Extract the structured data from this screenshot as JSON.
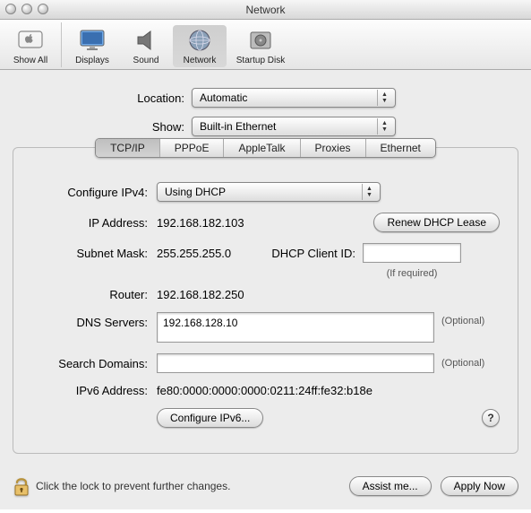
{
  "window": {
    "title": "Network"
  },
  "toolbar": {
    "items": [
      {
        "label": "Show All"
      },
      {
        "label": "Displays"
      },
      {
        "label": "Sound"
      },
      {
        "label": "Network"
      },
      {
        "label": "Startup Disk"
      }
    ]
  },
  "location": {
    "label": "Location:",
    "value": "Automatic"
  },
  "show": {
    "label": "Show:",
    "value": "Built-in Ethernet"
  },
  "tabs": [
    "TCP/IP",
    "PPPoE",
    "AppleTalk",
    "Proxies",
    "Ethernet"
  ],
  "activeTab": "TCP/IP",
  "tcpip": {
    "configure_label": "Configure IPv4:",
    "configure_value": "Using DHCP",
    "ip_label": "IP Address:",
    "ip_value": "192.168.182.103",
    "renew_label": "Renew DHCP Lease",
    "subnet_label": "Subnet Mask:",
    "subnet_value": "255.255.255.0",
    "client_id_label": "DHCP Client ID:",
    "client_id_value": "",
    "client_id_hint": "(If required)",
    "router_label": "Router:",
    "router_value": "192.168.182.250",
    "dns_label": "DNS Servers:",
    "dns_value": "192.168.128.10",
    "dns_optional": "(Optional)",
    "search_label": "Search Domains:",
    "search_value": "",
    "search_optional": "(Optional)",
    "ipv6_label": "IPv6 Address:",
    "ipv6_value": "fe80:0000:0000:0000:0211:24ff:fe32:b18e",
    "configure_ipv6_label": "Configure IPv6...",
    "help_label": "?"
  },
  "footer": {
    "lock_text": "Click the lock to prevent further changes.",
    "assist_label": "Assist me...",
    "apply_label": "Apply Now"
  }
}
